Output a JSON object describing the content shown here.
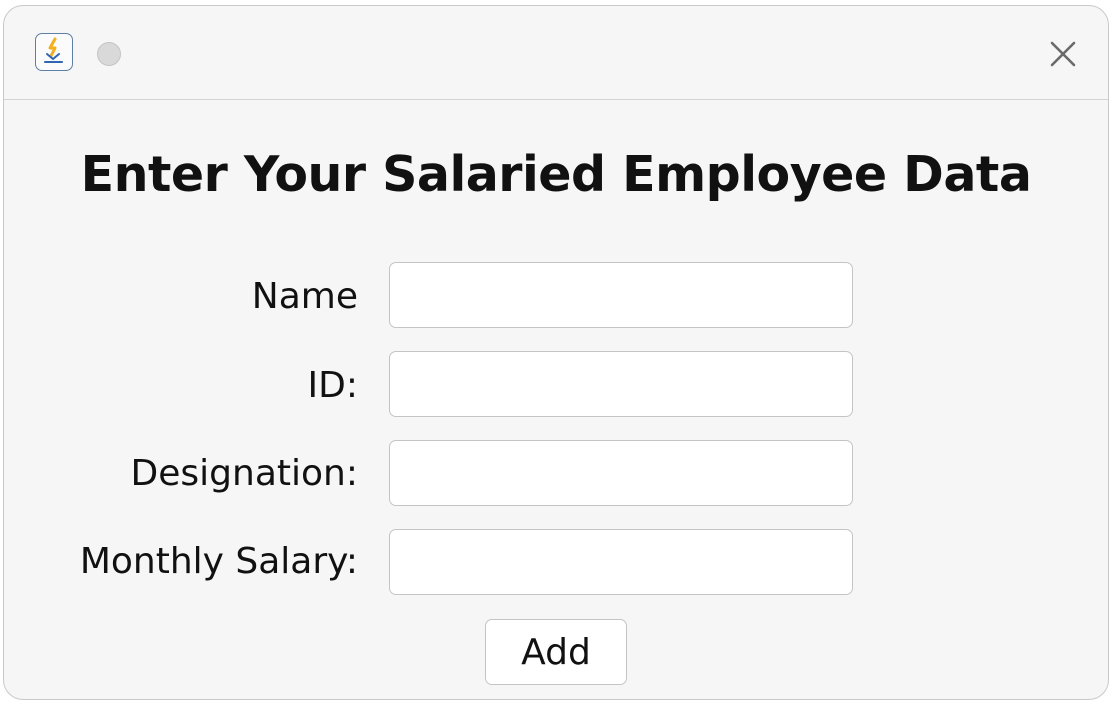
{
  "window": {
    "icons": {
      "app": "java-app-icon",
      "close": "close-icon"
    }
  },
  "form": {
    "heading": "Enter Your Salaried Employee Data",
    "fields": [
      {
        "label": "Name",
        "value": "",
        "placeholder": ""
      },
      {
        "label": "ID:",
        "value": "",
        "placeholder": ""
      },
      {
        "label": "Designation:",
        "value": "",
        "placeholder": ""
      },
      {
        "label": "Monthly Salary:",
        "value": "",
        "placeholder": ""
      }
    ],
    "add_label": "Add"
  },
  "colors": {
    "window_bg": "#f6f6f6",
    "field_bg": "#ffffff",
    "border": "#c4c4c4",
    "text": "#111111"
  }
}
